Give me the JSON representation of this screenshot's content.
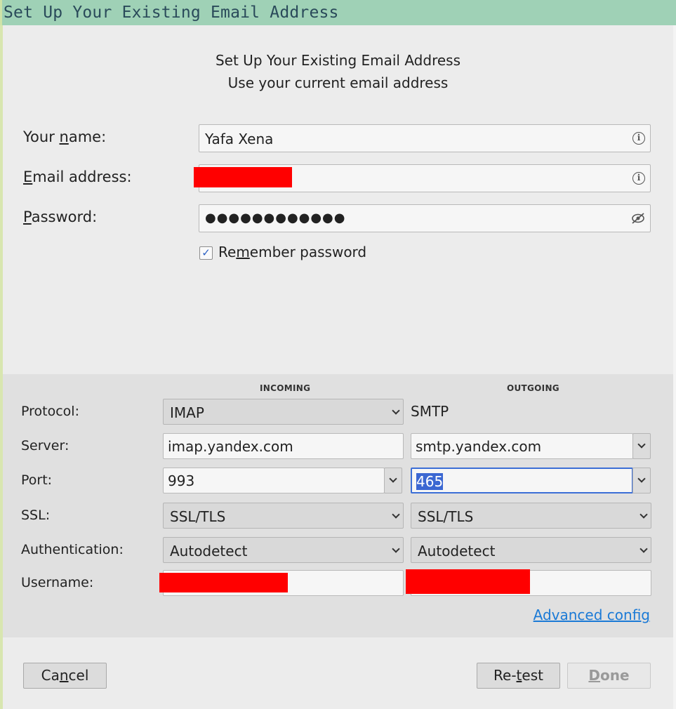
{
  "window": {
    "title": "Set Up Your Existing Email Address"
  },
  "header": {
    "title": "Set Up Your Existing Email Address",
    "subtitle": "Use your current email address"
  },
  "form": {
    "name_label_pre": "Your ",
    "name_label_u": "n",
    "name_label_post": "ame:",
    "name_value": "Yafa Xena",
    "email_label_u": "E",
    "email_label_post": "mail address:",
    "email_value": "",
    "password_label_u": "P",
    "password_label_post": "assword:",
    "password_mask": "●●●●●●●●●●●●",
    "remember_pre": "Re",
    "remember_u": "m",
    "remember_post": "ember password",
    "remember_checked": true,
    "check_glyph": "✓",
    "info_glyph": "i"
  },
  "server": {
    "incoming_header": "INCOMING",
    "outgoing_header": "OUTGOING",
    "labels": {
      "protocol": "Protocol:",
      "server": "Server:",
      "port": "Port:",
      "ssl": "SSL:",
      "auth": "Authentication:",
      "username": "Username:"
    },
    "incoming": {
      "protocol": "IMAP",
      "server": "imap.yandex.com",
      "port": "993",
      "ssl": "SSL/TLS",
      "auth": "Autodetect",
      "username": ""
    },
    "outgoing": {
      "protocol": "SMTP",
      "server": "smtp.yandex.com",
      "port": "465",
      "ssl": "SSL/TLS",
      "auth": "Autodetect",
      "username": ""
    },
    "advanced_pre": "",
    "advanced_u": "A",
    "advanced_post": "dvanced config"
  },
  "buttons": {
    "cancel_pre": "Ca",
    "cancel_u": "n",
    "cancel_post": "cel",
    "retest_pre": "Re-",
    "retest_u": "t",
    "retest_post": "est",
    "done_u": "D",
    "done_post": "one"
  },
  "colors": {
    "titlebar": "#9fd1b6",
    "link": "#1b7ad6",
    "focus": "#3b6ed6",
    "redaction": "#ff0000"
  },
  "icons": {
    "info": "info-circle-icon",
    "password_visibility": "eye-slash-icon",
    "dropdown": "chevron-down-icon"
  }
}
